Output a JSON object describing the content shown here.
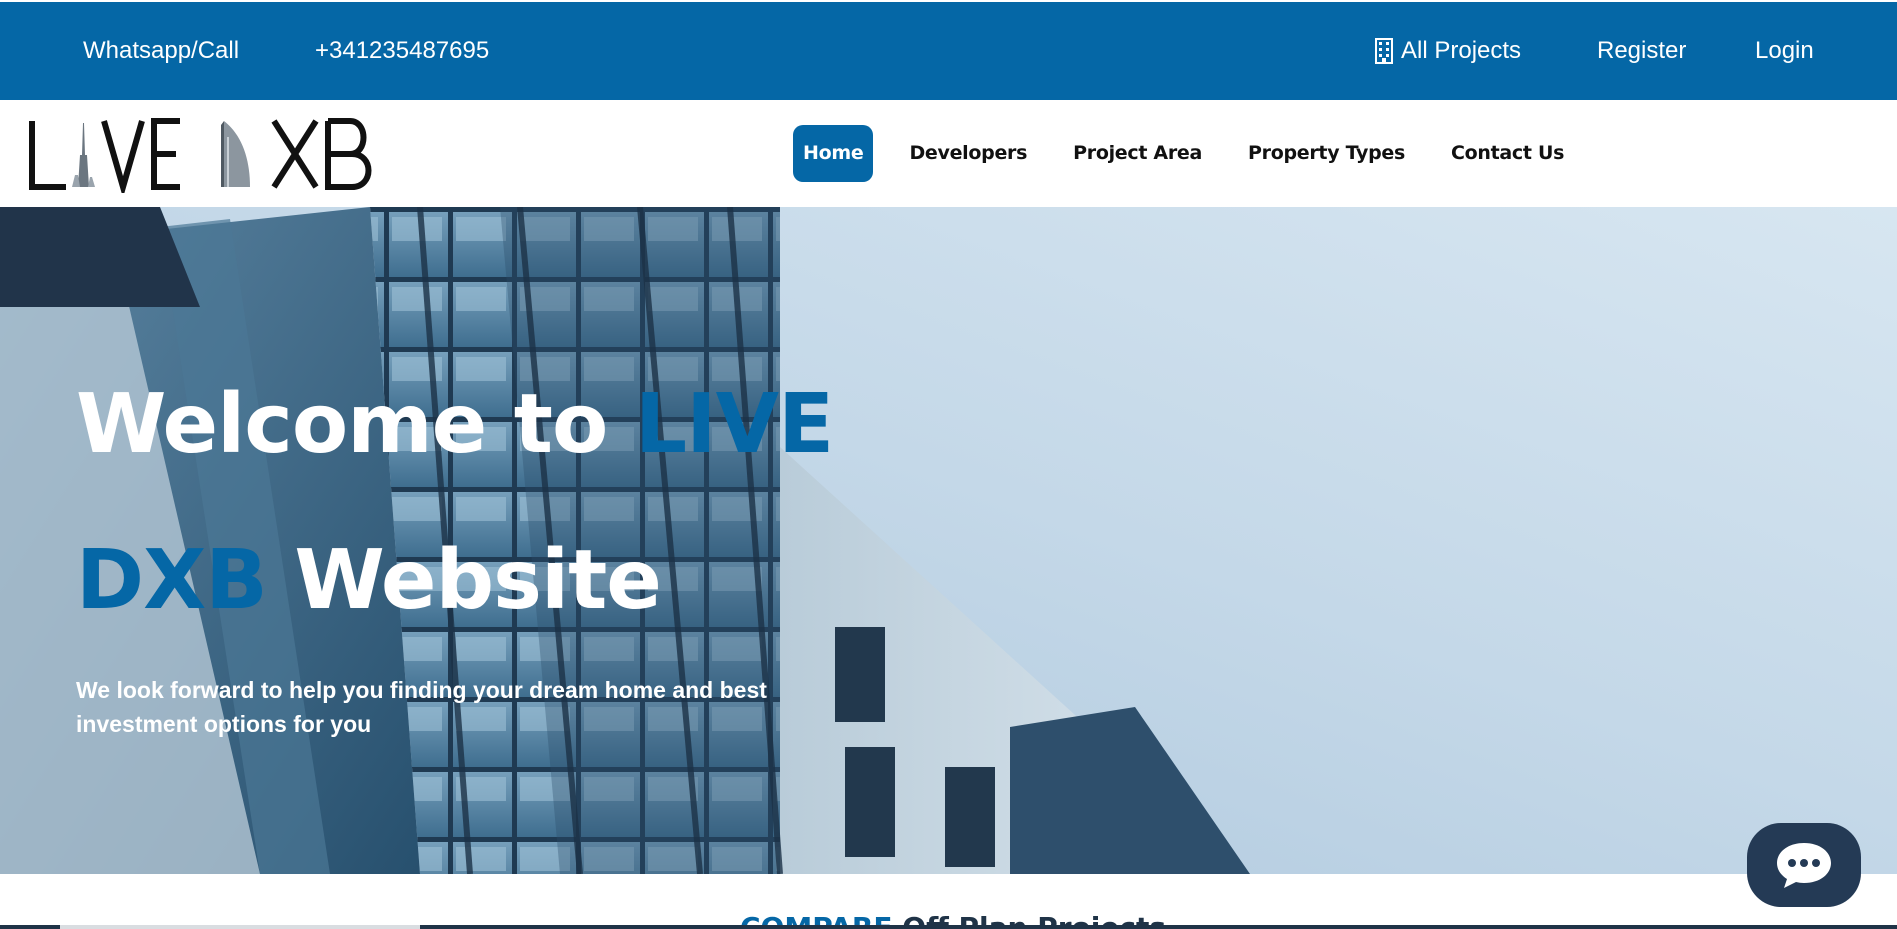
{
  "topbar": {
    "whatsapp_label": "Whatsapp/Call",
    "phone": "+341235487695",
    "all_projects_label": "All Projects",
    "all_projects_icon": "building-icon",
    "register_label": "Register",
    "login_label": "Login"
  },
  "header": {
    "logo_text": "LIVE DXB",
    "nav": [
      {
        "label": "Home",
        "active": true
      },
      {
        "label": "Developers",
        "active": false
      },
      {
        "label": "Project Area",
        "active": false
      },
      {
        "label": "Property Types",
        "active": false
      },
      {
        "label": "Contact Us",
        "active": false
      }
    ]
  },
  "hero": {
    "title_part1": "Welcome to ",
    "title_accent1": "LIVE",
    "title_accent2": "DXB",
    "title_part2": " Website",
    "subtitle": "We look forward to help you finding your dream home and best investment options for you"
  },
  "below_hero": {
    "peek_accent": "COMPARE",
    "peek_text": " Off Plan Projects"
  },
  "chat": {
    "icon": "chat-bubble-icon"
  },
  "colors": {
    "brand_blue": "#0567a6",
    "dark_navy": "#243a55",
    "white": "#ffffff"
  }
}
